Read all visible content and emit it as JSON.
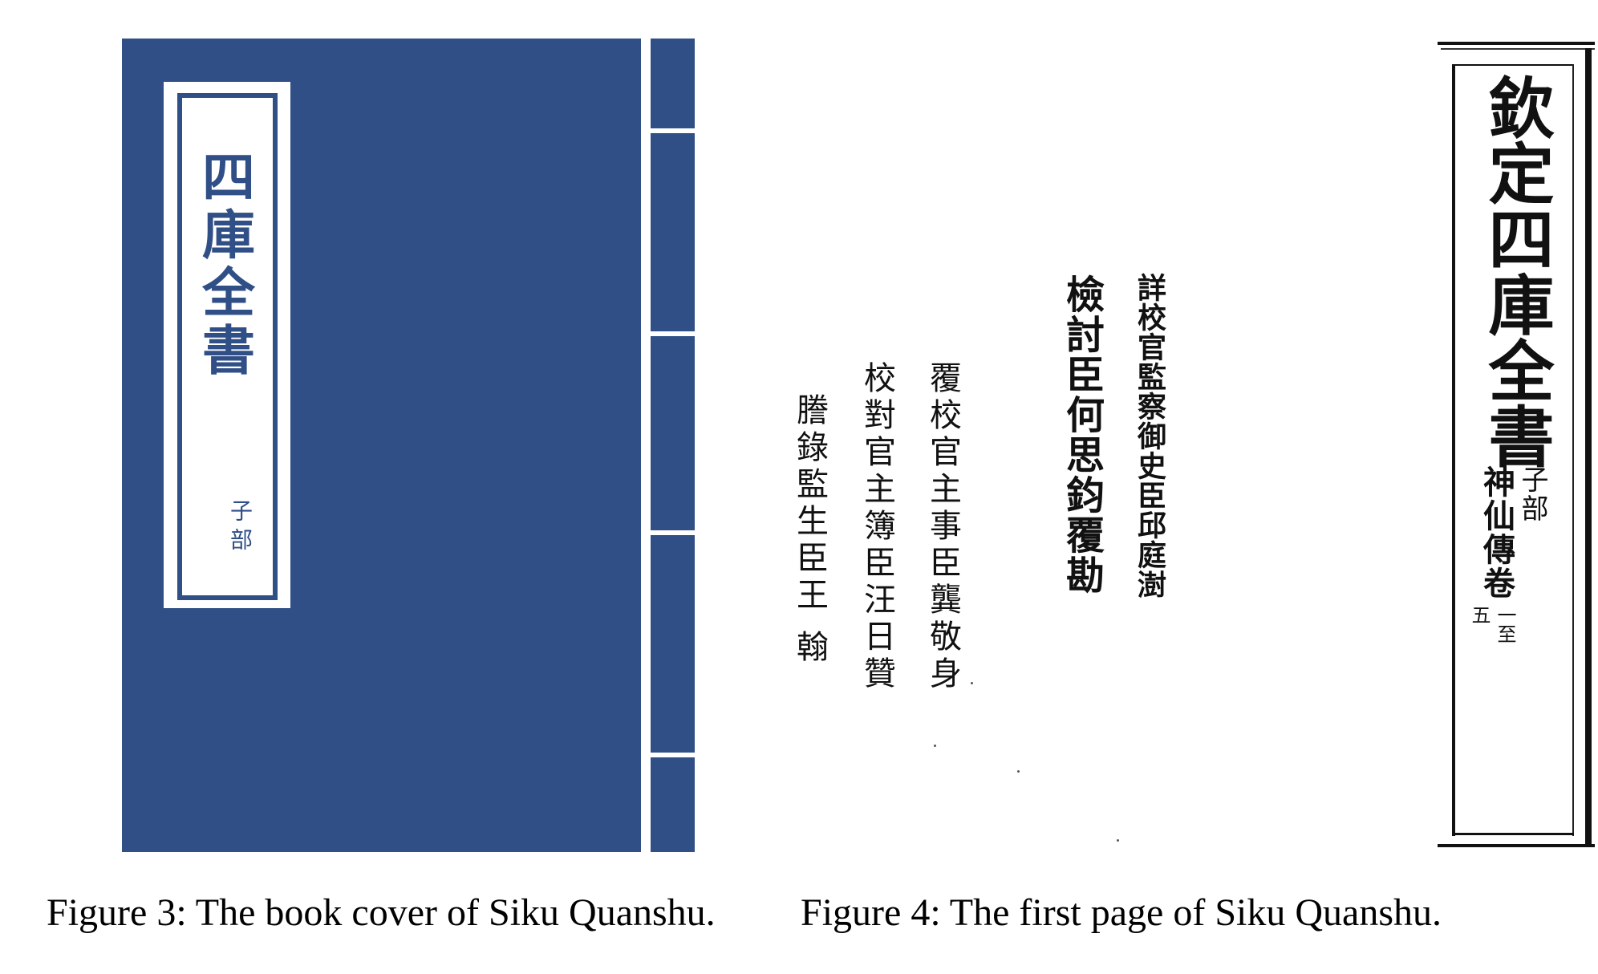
{
  "figure3": {
    "caption": "Figure 3: The book cover of Siku Quanshu.",
    "cover_title": "四庫全書",
    "cover_subtitle": "子部",
    "colors": {
      "cover_blue": "#304f86",
      "label_white": "#ffffff"
    }
  },
  "figure4": {
    "caption": "Figure 4: The first page of Siku Quanshu.",
    "credits": {
      "col1": "詳校官監察御史臣邱庭澍",
      "col2": "檢討臣何思鈞覆勘",
      "col3": "覆校官主事臣龔敬身",
      "col4": "校對官主簿臣汪日贊",
      "col5": "謄錄監生臣王 翰"
    },
    "title_page": {
      "title": "欽定四庫全書",
      "section": "子部",
      "work": "神仙傳卷",
      "volume_a": "一至",
      "volume_b": "五"
    }
  }
}
